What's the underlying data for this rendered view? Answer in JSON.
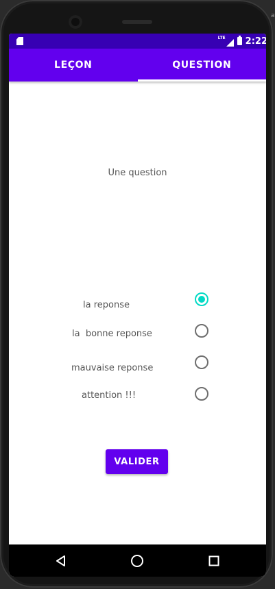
{
  "status_bar": {
    "time": "2:22",
    "network": "LTE"
  },
  "tabs": [
    {
      "label": "LEÇON",
      "selected": false
    },
    {
      "label": "QUESTION",
      "selected": true
    }
  ],
  "question": {
    "text": "Une question"
  },
  "answers": [
    {
      "label": "la reponse",
      "checked": true
    },
    {
      "label": "la  bonne reponse",
      "checked": false
    },
    {
      "label": "mauvaise reponse",
      "checked": false
    },
    {
      "label": "attention !!!",
      "checked": false
    }
  ],
  "validate_button": {
    "label": "VALIDER"
  },
  "colors": {
    "status_bar": "#3700b3",
    "primary": "#6200ee",
    "accent": "#03dac5"
  },
  "icons": {
    "status": [
      "sd-card-icon",
      "lte-signal-icon",
      "battery-charging-icon"
    ],
    "navigation": [
      "back-icon",
      "home-icon",
      "recents-icon"
    ]
  }
}
